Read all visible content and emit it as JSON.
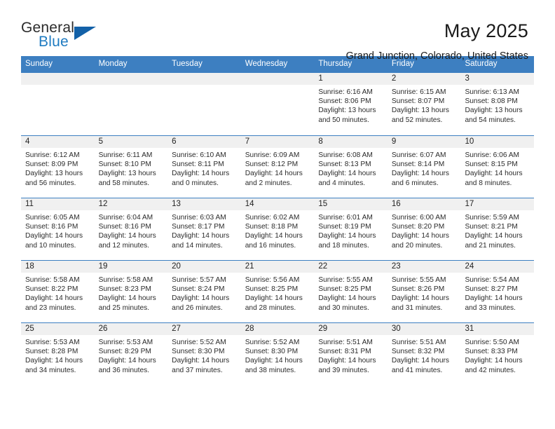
{
  "logo": {
    "primary": "General",
    "secondary": "Blue",
    "triangle_color": "#1361a8",
    "secondary_color": "#1f7bc1"
  },
  "header": {
    "title": "May 2025",
    "subtitle": "Grand Junction, Colorado, United States"
  },
  "theme": {
    "header_bar": "#3d7fc1",
    "daynum_strip": "#f0f0f0",
    "text": "#2b2b2b"
  },
  "calendar": {
    "weekday_headers": [
      "Sunday",
      "Monday",
      "Tuesday",
      "Wednesday",
      "Thursday",
      "Friday",
      "Saturday"
    ],
    "weeks": [
      [
        {
          "day": "",
          "empty": true
        },
        {
          "day": "",
          "empty": true
        },
        {
          "day": "",
          "empty": true
        },
        {
          "day": "",
          "empty": true
        },
        {
          "day": "1",
          "sunrise": "Sunrise: 6:16 AM",
          "sunset": "Sunset: 8:06 PM",
          "daylight": "Daylight: 13 hours and 50 minutes."
        },
        {
          "day": "2",
          "sunrise": "Sunrise: 6:15 AM",
          "sunset": "Sunset: 8:07 PM",
          "daylight": "Daylight: 13 hours and 52 minutes."
        },
        {
          "day": "3",
          "sunrise": "Sunrise: 6:13 AM",
          "sunset": "Sunset: 8:08 PM",
          "daylight": "Daylight: 13 hours and 54 minutes."
        }
      ],
      [
        {
          "day": "4",
          "sunrise": "Sunrise: 6:12 AM",
          "sunset": "Sunset: 8:09 PM",
          "daylight": "Daylight: 13 hours and 56 minutes."
        },
        {
          "day": "5",
          "sunrise": "Sunrise: 6:11 AM",
          "sunset": "Sunset: 8:10 PM",
          "daylight": "Daylight: 13 hours and 58 minutes."
        },
        {
          "day": "6",
          "sunrise": "Sunrise: 6:10 AM",
          "sunset": "Sunset: 8:11 PM",
          "daylight": "Daylight: 14 hours and 0 minutes."
        },
        {
          "day": "7",
          "sunrise": "Sunrise: 6:09 AM",
          "sunset": "Sunset: 8:12 PM",
          "daylight": "Daylight: 14 hours and 2 minutes."
        },
        {
          "day": "8",
          "sunrise": "Sunrise: 6:08 AM",
          "sunset": "Sunset: 8:13 PM",
          "daylight": "Daylight: 14 hours and 4 minutes."
        },
        {
          "day": "9",
          "sunrise": "Sunrise: 6:07 AM",
          "sunset": "Sunset: 8:14 PM",
          "daylight": "Daylight: 14 hours and 6 minutes."
        },
        {
          "day": "10",
          "sunrise": "Sunrise: 6:06 AM",
          "sunset": "Sunset: 8:15 PM",
          "daylight": "Daylight: 14 hours and 8 minutes."
        }
      ],
      [
        {
          "day": "11",
          "sunrise": "Sunrise: 6:05 AM",
          "sunset": "Sunset: 8:16 PM",
          "daylight": "Daylight: 14 hours and 10 minutes."
        },
        {
          "day": "12",
          "sunrise": "Sunrise: 6:04 AM",
          "sunset": "Sunset: 8:16 PM",
          "daylight": "Daylight: 14 hours and 12 minutes."
        },
        {
          "day": "13",
          "sunrise": "Sunrise: 6:03 AM",
          "sunset": "Sunset: 8:17 PM",
          "daylight": "Daylight: 14 hours and 14 minutes."
        },
        {
          "day": "14",
          "sunrise": "Sunrise: 6:02 AM",
          "sunset": "Sunset: 8:18 PM",
          "daylight": "Daylight: 14 hours and 16 minutes."
        },
        {
          "day": "15",
          "sunrise": "Sunrise: 6:01 AM",
          "sunset": "Sunset: 8:19 PM",
          "daylight": "Daylight: 14 hours and 18 minutes."
        },
        {
          "day": "16",
          "sunrise": "Sunrise: 6:00 AM",
          "sunset": "Sunset: 8:20 PM",
          "daylight": "Daylight: 14 hours and 20 minutes."
        },
        {
          "day": "17",
          "sunrise": "Sunrise: 5:59 AM",
          "sunset": "Sunset: 8:21 PM",
          "daylight": "Daylight: 14 hours and 21 minutes."
        }
      ],
      [
        {
          "day": "18",
          "sunrise": "Sunrise: 5:58 AM",
          "sunset": "Sunset: 8:22 PM",
          "daylight": "Daylight: 14 hours and 23 minutes."
        },
        {
          "day": "19",
          "sunrise": "Sunrise: 5:58 AM",
          "sunset": "Sunset: 8:23 PM",
          "daylight": "Daylight: 14 hours and 25 minutes."
        },
        {
          "day": "20",
          "sunrise": "Sunrise: 5:57 AM",
          "sunset": "Sunset: 8:24 PM",
          "daylight": "Daylight: 14 hours and 26 minutes."
        },
        {
          "day": "21",
          "sunrise": "Sunrise: 5:56 AM",
          "sunset": "Sunset: 8:25 PM",
          "daylight": "Daylight: 14 hours and 28 minutes."
        },
        {
          "day": "22",
          "sunrise": "Sunrise: 5:55 AM",
          "sunset": "Sunset: 8:25 PM",
          "daylight": "Daylight: 14 hours and 30 minutes."
        },
        {
          "day": "23",
          "sunrise": "Sunrise: 5:55 AM",
          "sunset": "Sunset: 8:26 PM",
          "daylight": "Daylight: 14 hours and 31 minutes."
        },
        {
          "day": "24",
          "sunrise": "Sunrise: 5:54 AM",
          "sunset": "Sunset: 8:27 PM",
          "daylight": "Daylight: 14 hours and 33 minutes."
        }
      ],
      [
        {
          "day": "25",
          "sunrise": "Sunrise: 5:53 AM",
          "sunset": "Sunset: 8:28 PM",
          "daylight": "Daylight: 14 hours and 34 minutes."
        },
        {
          "day": "26",
          "sunrise": "Sunrise: 5:53 AM",
          "sunset": "Sunset: 8:29 PM",
          "daylight": "Daylight: 14 hours and 36 minutes."
        },
        {
          "day": "27",
          "sunrise": "Sunrise: 5:52 AM",
          "sunset": "Sunset: 8:30 PM",
          "daylight": "Daylight: 14 hours and 37 minutes."
        },
        {
          "day": "28",
          "sunrise": "Sunrise: 5:52 AM",
          "sunset": "Sunset: 8:30 PM",
          "daylight": "Daylight: 14 hours and 38 minutes."
        },
        {
          "day": "29",
          "sunrise": "Sunrise: 5:51 AM",
          "sunset": "Sunset: 8:31 PM",
          "daylight": "Daylight: 14 hours and 39 minutes."
        },
        {
          "day": "30",
          "sunrise": "Sunrise: 5:51 AM",
          "sunset": "Sunset: 8:32 PM",
          "daylight": "Daylight: 14 hours and 41 minutes."
        },
        {
          "day": "31",
          "sunrise": "Sunrise: 5:50 AM",
          "sunset": "Sunset: 8:33 PM",
          "daylight": "Daylight: 14 hours and 42 minutes."
        }
      ]
    ]
  }
}
